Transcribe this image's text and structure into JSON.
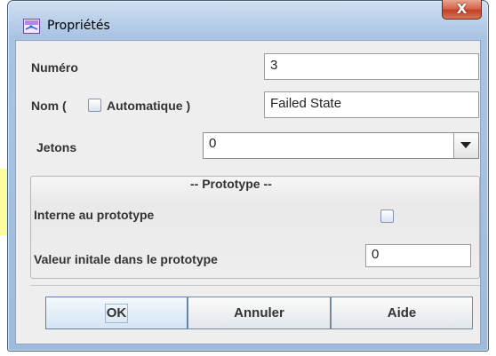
{
  "window": {
    "title": "Propriétés",
    "close_label": "X"
  },
  "form": {
    "numero_label": "Numéro",
    "numero_value": "3",
    "nom_prefix": "Nom (",
    "nom_auto_label": "Automatique )",
    "nom_value": "Failed State",
    "jetons_label": "Jetons",
    "jetons_value": "0"
  },
  "prototype": {
    "title": "-- Prototype --",
    "interne_label": "Interne au prototype",
    "valeur_label": "Valeur initale dans le prototype",
    "valeur_value": "0"
  },
  "buttons": {
    "ok": "OK",
    "annuler": "Annuler",
    "aide": "Aide"
  },
  "colors": {
    "frame": "#a9c4e3",
    "close_button": "#c8472a",
    "client_bg": "#eeeeee"
  }
}
